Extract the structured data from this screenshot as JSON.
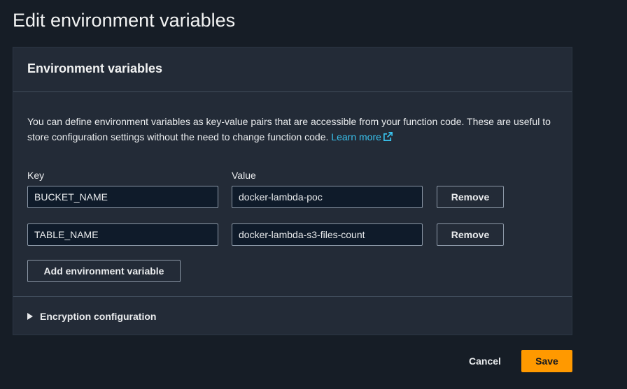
{
  "page": {
    "title": "Edit environment variables"
  },
  "panel": {
    "title": "Environment variables",
    "description": "You can define environment variables as key-value pairs that are accessible from your function code. These are useful to store configuration settings without the need to change function code.",
    "learn_more": "Learn more",
    "learn_more_icon": "external-link-icon",
    "key_label": "Key",
    "value_label": "Value",
    "variables": [
      {
        "key": "BUCKET_NAME",
        "value": "docker-lambda-poc",
        "remove_label": "Remove"
      },
      {
        "key": "TABLE_NAME",
        "value": "docker-lambda-s3-files-count",
        "remove_label": "Remove"
      }
    ],
    "add_button": "Add environment variable",
    "encryption_label": "Encryption configuration",
    "encryption_icon": "caret-right-icon"
  },
  "footer": {
    "cancel_label": "Cancel",
    "save_label": "Save"
  },
  "colors": {
    "accent": "#ff9900",
    "link": "#39c2ee",
    "background": "#161d26",
    "panel": "#232b37"
  }
}
